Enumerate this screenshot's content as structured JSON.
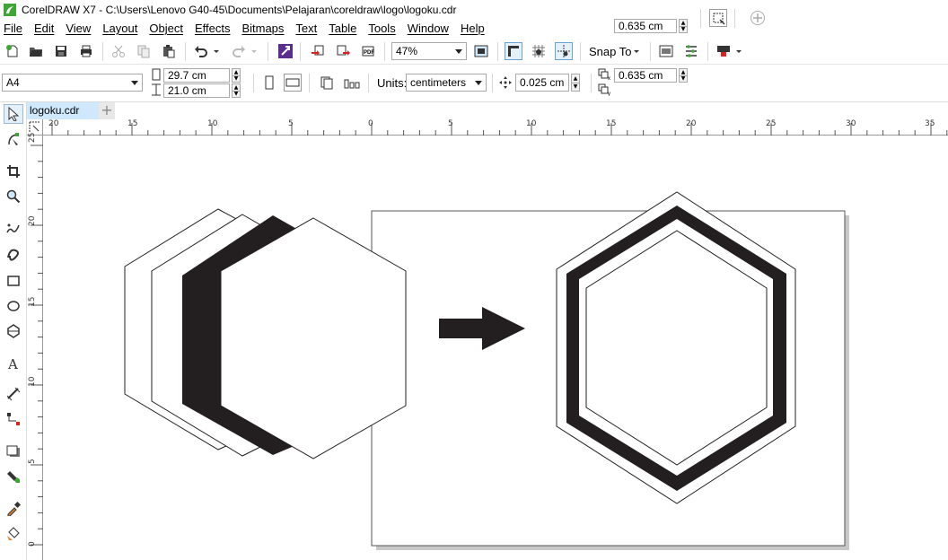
{
  "window": {
    "title": "CorelDRAW X7 - C:\\Users\\Lenovo G40-45\\Documents\\Pelajaran\\coreldraw\\logo\\logoku.cdr"
  },
  "menu": [
    "File",
    "Edit",
    "View",
    "Layout",
    "Object",
    "Effects",
    "Bitmaps",
    "Text",
    "Table",
    "Tools",
    "Window",
    "Help"
  ],
  "standard_toolbar": {
    "zoom_level": "47%",
    "snap_to_label": "Snap To"
  },
  "property_bar": {
    "page_size": "A4",
    "page_width": "29.7 cm",
    "page_height": "21.0 cm",
    "units_label": "Units:",
    "units_value": "centimeters",
    "nudge_distance": "0.025 cm",
    "duplicate_x": "0.635 cm",
    "duplicate_y": "0.635 cm"
  },
  "document_tabs": [
    {
      "label": "logoku.cdr",
      "active": true
    }
  ],
  "rulers": {
    "horizontal_labels": [
      "20",
      "15",
      "10",
      "5",
      "0",
      "5",
      "10",
      "15",
      "20",
      "25",
      "30",
      "35"
    ],
    "vertical_labels": [
      "25",
      "20",
      "15",
      "10",
      "5",
      "0"
    ]
  },
  "colors": {
    "accent_logo_green": "#3fa535",
    "tab_active": "#cfe8fb",
    "artwork_black": "#231f20",
    "page_shadow": "#c8c8c8"
  },
  "icons": [
    "new-document-icon",
    "open-folder-icon",
    "save-icon",
    "print-icon",
    "cut-icon",
    "copy-icon",
    "paste-icon",
    "undo-icon",
    "redo-icon",
    "search-content-icon",
    "import-icon",
    "export-icon",
    "publish-pdf-icon",
    "full-screen-preview-icon",
    "show-rulers-icon",
    "show-grid-icon",
    "show-guidelines-icon",
    "options-icon",
    "application-launcher-icon"
  ]
}
